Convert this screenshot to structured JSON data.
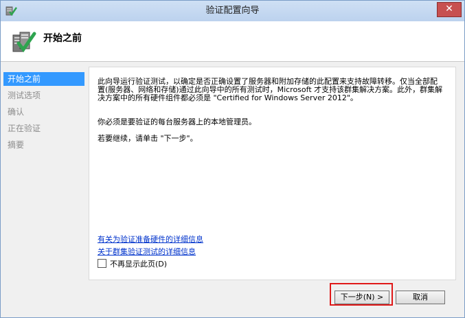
{
  "window": {
    "title": "验证配置向导",
    "close_symbol": "✕"
  },
  "header": {
    "title": "开始之前",
    "icon": "validate-check-icon"
  },
  "nav": {
    "items": [
      {
        "label": "开始之前",
        "active": true
      },
      {
        "label": "测试选项",
        "active": false
      },
      {
        "label": "确认",
        "active": false
      },
      {
        "label": "正在验证",
        "active": false
      },
      {
        "label": "摘要",
        "active": false
      }
    ]
  },
  "content": {
    "para1": "此向导运行验证测试，以确定是否正确设置了服务器和附加存储的此配置来支持故障转移。仅当全部配置(服务器、网络和存储)通过此向导中的所有测试时，Microsoft 才支持该群集解决方案。此外，群集解决方案中的所有硬件组件都必须是 \"Certified for Windows Server 2012\"。",
    "para2": "你必须是要验证的每台服务器上的本地管理员。",
    "para3": "若要继续，请单击 \"下一步\"。",
    "link1": "有关为验证准备硬件的详细信息",
    "link2": "关于群集验证测试的详细信息",
    "checkbox_label": "不再显示此页(D)",
    "checkbox_checked": false
  },
  "footer": {
    "next_label": "下一步(N) >",
    "cancel_label": "取消"
  },
  "colors": {
    "accent": "#3399ff",
    "highlight": "#e01818",
    "link": "#0033cc"
  }
}
